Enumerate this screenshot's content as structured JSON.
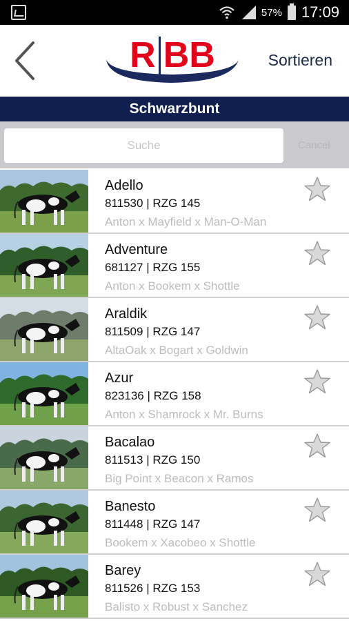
{
  "statusbar": {
    "battery": "57%",
    "time": "17:09",
    "icons": [
      "gallery-icon",
      "wifi-icon",
      "signal-icon",
      "battery-icon"
    ]
  },
  "navbar": {
    "back_icon": "chevron-left-icon",
    "logo_letters": [
      "R",
      "BB"
    ],
    "sort_label": "Sortieren"
  },
  "section": {
    "title": "Schwarzbunt"
  },
  "search": {
    "placeholder": "Suche",
    "value": "",
    "cancel_label": "Cancel"
  },
  "colors": {
    "header_blue": "#0f2050",
    "logo_red": "#e2001a",
    "pedigree_gray": "#bdbdbd"
  },
  "bulls": [
    {
      "name": "Adello",
      "code": "811530 | RZG 145",
      "pedigree": "Anton x Mayfield x Man-O-Man",
      "favorite": false
    },
    {
      "name": "Adventure",
      "code": "681127 | RZG 155",
      "pedigree": "Anton x Bookem x Shottle",
      "favorite": false
    },
    {
      "name": "Araldik",
      "code": "811509 | RZG 147",
      "pedigree": "AltaOak x Bogart x Goldwin",
      "favorite": false
    },
    {
      "name": "Azur",
      "code": "823136 | RZG 158",
      "pedigree": "Anton x Shamrock x Mr. Burns",
      "favorite": false
    },
    {
      "name": "Bacalao",
      "code": "811513 | RZG 150",
      "pedigree": "Big Point x Beacon x Ramos",
      "favorite": false
    },
    {
      "name": "Banesto",
      "code": "811448 | RZG 147",
      "pedigree": "Bookem x Xacobeo x Shottle",
      "favorite": false
    },
    {
      "name": "Barey",
      "code": "811526 | RZG 153",
      "pedigree": "Balisto x Robust x Sanchez",
      "favorite": false
    }
  ]
}
